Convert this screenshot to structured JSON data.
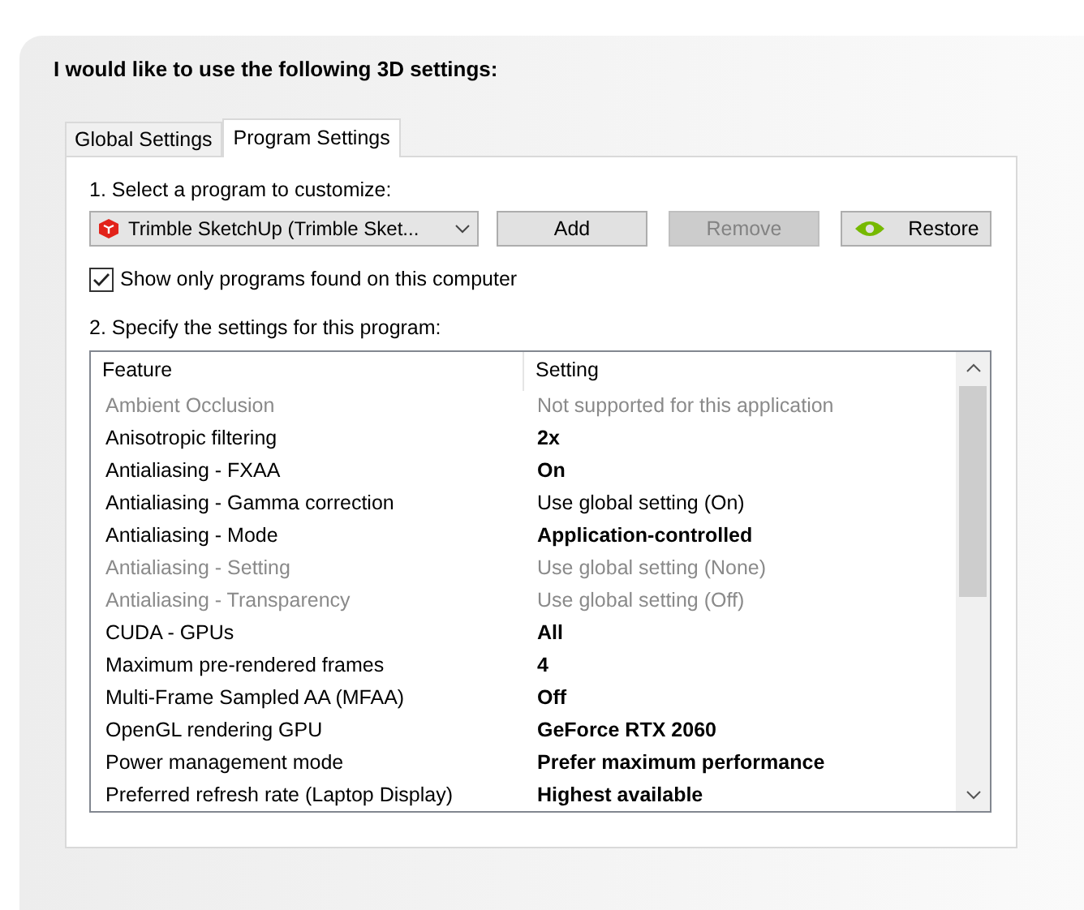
{
  "heading": "I would like to use the following 3D settings:",
  "tabs": [
    {
      "label": "Global Settings",
      "selected": false
    },
    {
      "label": "Program Settings",
      "selected": true
    }
  ],
  "step_1": "1. Select a program to customize:",
  "program_dropdown": {
    "value": "Trimble SketchUp (Trimble Sket..."
  },
  "buttons": [
    {
      "label": "Add",
      "disabled": false,
      "kind": "plain"
    },
    {
      "label": "Remove",
      "disabled": true,
      "kind": "plain"
    },
    {
      "label": "Restore",
      "disabled": false,
      "kind": "restore"
    }
  ],
  "show_only_found": {
    "label": "Show only programs found on this computer",
    "checked": true
  },
  "step_2": "2. Specify the settings for this program:",
  "table": {
    "columns": [
      "Feature",
      "Setting"
    ],
    "rows": [
      {
        "feature": "Ambient Occlusion",
        "setting": "Not supported for this application",
        "disabled": true,
        "overridden": false
      },
      {
        "feature": "Anisotropic filtering",
        "setting": "2x",
        "disabled": false,
        "overridden": true
      },
      {
        "feature": "Antialiasing - FXAA",
        "setting": "On",
        "disabled": false,
        "overridden": true
      },
      {
        "feature": "Antialiasing - Gamma correction",
        "setting": "Use global setting (On)",
        "disabled": false,
        "overridden": false
      },
      {
        "feature": "Antialiasing - Mode",
        "setting": "Application-controlled",
        "disabled": false,
        "overridden": true
      },
      {
        "feature": "Antialiasing - Setting",
        "setting": "Use global setting (None)",
        "disabled": true,
        "overridden": false
      },
      {
        "feature": "Antialiasing - Transparency",
        "setting": "Use global setting (Off)",
        "disabled": true,
        "overridden": false
      },
      {
        "feature": "CUDA - GPUs",
        "setting": "All",
        "disabled": false,
        "overridden": true
      },
      {
        "feature": "Maximum pre-rendered frames",
        "setting": "4",
        "disabled": false,
        "overridden": true
      },
      {
        "feature": "Multi-Frame Sampled AA (MFAA)",
        "setting": "Off",
        "disabled": false,
        "overridden": true
      },
      {
        "feature": "OpenGL rendering GPU",
        "setting": "GeForce RTX 2060",
        "disabled": false,
        "overridden": true
      },
      {
        "feature": "Power management mode",
        "setting": "Prefer maximum performance",
        "disabled": false,
        "overridden": true
      },
      {
        "feature": "Preferred refresh rate (Laptop Display)",
        "setting": "Highest available",
        "disabled": false,
        "overridden": true
      }
    ]
  }
}
